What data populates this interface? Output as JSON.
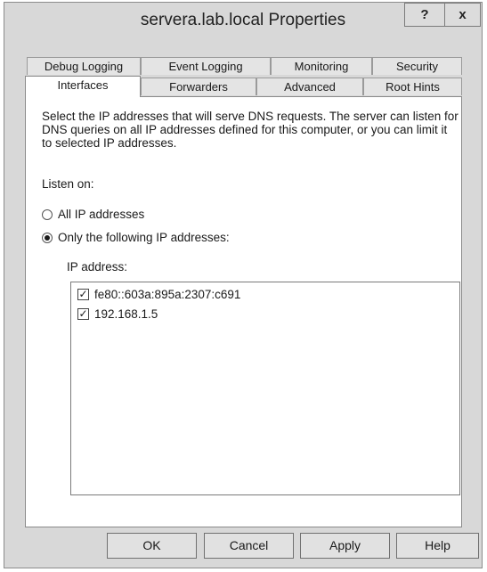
{
  "window": {
    "title": "servera.lab.local Properties"
  },
  "titlebar": {
    "help_glyph": "?",
    "close_glyph": "x"
  },
  "tabs": {
    "row1": [
      "Debug Logging",
      "Event Logging",
      "Monitoring",
      "Security"
    ],
    "row2": [
      "Interfaces",
      "Forwarders",
      "Advanced",
      "Root Hints"
    ],
    "active": "Interfaces"
  },
  "interfaces": {
    "description": "Select the IP addresses that will serve DNS requests. The server can listen for DNS queries on all IP addresses defined for this computer, or you can limit it to selected IP addresses.",
    "listen_on_label": "Listen on:",
    "options": [
      {
        "label": "All IP addresses",
        "selected": false
      },
      {
        "label": "Only the following IP addresses:",
        "selected": true
      }
    ],
    "ip_label": "IP address:",
    "ip_list": [
      {
        "address": "fe80::603a:895a:2307:c691",
        "checked": true
      },
      {
        "address": "192.168.1.5",
        "checked": true
      }
    ]
  },
  "buttons": {
    "ok": "OK",
    "cancel": "Cancel",
    "apply": "Apply",
    "help": "Help"
  }
}
